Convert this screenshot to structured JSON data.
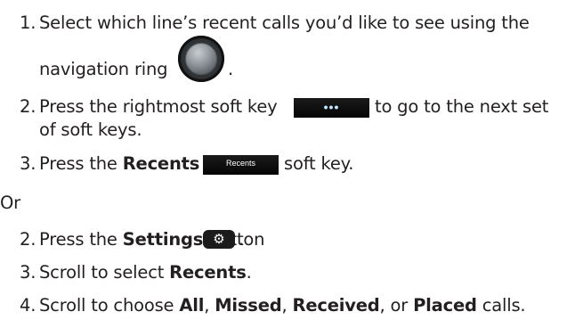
{
  "steps": [
    {
      "num": "1.",
      "line1": "Select which line’s recent calls you’d like to see using the",
      "line2": "navigation ring",
      "after_icon": "."
    },
    {
      "num": "2.",
      "before_key": "Press the rightmost soft key",
      "key_label": "•••",
      "after_key": "to go to the next set",
      "line2": "of soft keys."
    },
    {
      "num": "3.",
      "pre": "Press the",
      "bold": "Recents",
      "key_label": "Recents",
      "post": "soft key."
    }
  ],
  "or_label": "Or",
  "alt_steps": [
    {
      "num": "2.",
      "pre": "Press the",
      "bold": "Settings",
      "mid": "button",
      "icon": "gear-icon",
      "post": "."
    },
    {
      "num": "3.",
      "pre": "Scroll to select",
      "bold": "Recents",
      "post": "."
    },
    {
      "num": "4.",
      "pre": "Scroll to choose",
      "opt1": "All",
      "sep1": ",",
      "opt2": "Missed",
      "sep2": ",",
      "opt3": "Received",
      "sep3": ", or",
      "opt4": "Placed",
      "post": "calls."
    }
  ]
}
